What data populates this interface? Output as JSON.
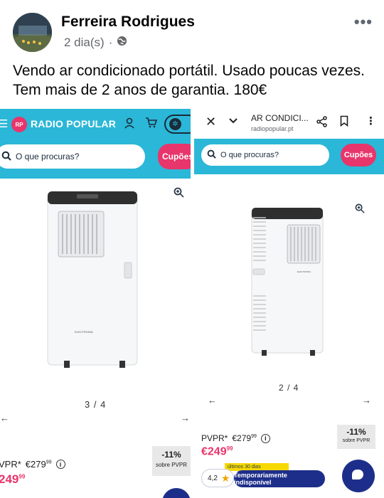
{
  "post": {
    "author": "Ferreira Rodrigues",
    "time": "2 dia(s)",
    "separator": "·",
    "text": "Vendo ar condicionado portátil. Usado poucas vezes. Tem mais de 2 anos de garantia. 180€",
    "more_glyph": "•••"
  },
  "left_screen": {
    "site_name": "RADIO POPULAR",
    "logo_text": "RP",
    "search_placeholder": "O que procuras?",
    "coupons_label": "Cupões",
    "pager": "3 / 4",
    "pvpr_label": "VPR*",
    "pvpr_price": "€279",
    "pvpr_cents": "99",
    "price": "249",
    "price_cents": "99",
    "discount": "-11%",
    "discount_sub": "sobre PVPR",
    "brand": "ELECTRONIA"
  },
  "right_screen": {
    "page_title": "AR CONDICI...",
    "page_url": "radiopopular.pt",
    "search_placeholder": "O que procuras?",
    "coupons_label": "Cupões",
    "pager": "2 / 4",
    "pvpr_label": "PVPR*",
    "pvpr_price": "€279",
    "pvpr_cents": "99",
    "price": "€249",
    "price_cents": "99",
    "discount": "-11%",
    "discount_sub": "sobre PVPR",
    "lowest_price_note": "últimos 30 dias",
    "rating": "4,2",
    "unavailable_label": "Temporariamente indisponível",
    "brand": "ELECTRONIA"
  },
  "icons": {
    "globe": "globe-icon",
    "zoom": "zoom-in-icon",
    "close": "close-icon",
    "chevron": "chevron-down-icon",
    "share": "share-icon",
    "bookmark": "bookmark-icon",
    "menu": "more-vert-icon",
    "user": "user-icon",
    "cart": "cart-icon",
    "search": "search-icon",
    "star": "star-icon",
    "chat": "chat-icon"
  },
  "colors": {
    "brand_teal": "#2bb7d7",
    "brand_pink": "#e8356b",
    "navy": "#1d2e8a",
    "promo_yellow": "#f6d900"
  }
}
